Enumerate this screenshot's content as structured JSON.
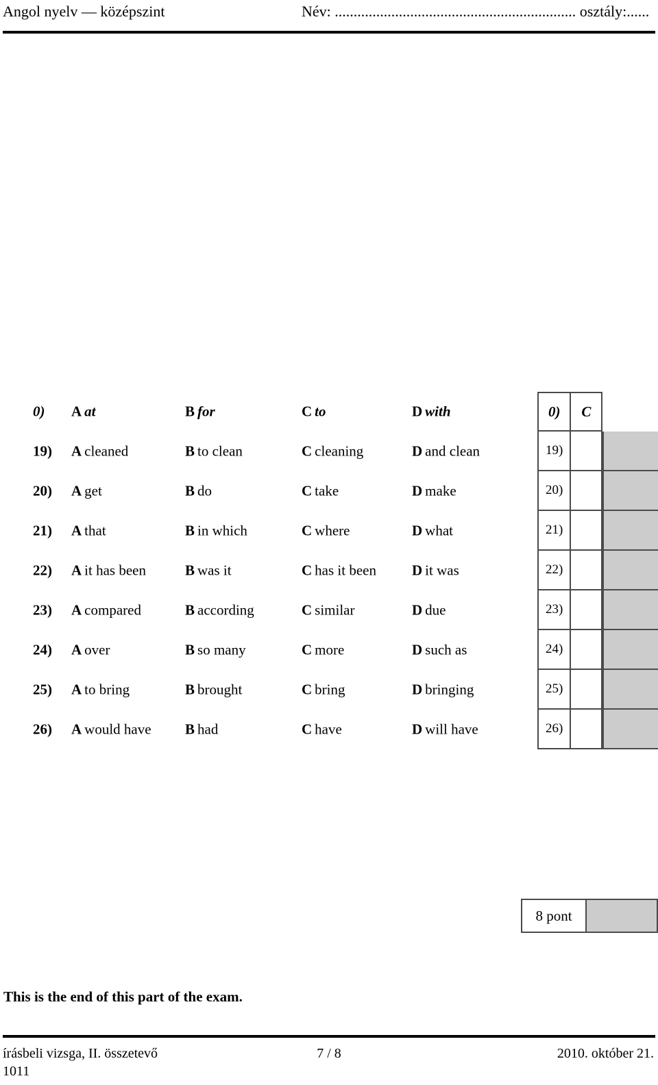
{
  "header": {
    "subject": "Angol nyelv — középszint",
    "name_field": "Név: ................................................................ osztály:......"
  },
  "example_row": {
    "number": "0)",
    "options": [
      {
        "letter": "A",
        "text": "at"
      },
      {
        "letter": "B",
        "text": "for"
      },
      {
        "letter": "C",
        "text": "to"
      },
      {
        "letter": "D",
        "text": "with"
      }
    ],
    "answer_number": "0)",
    "answer_value": "C"
  },
  "questions": [
    {
      "number": "19)",
      "options": [
        {
          "letter": "A",
          "text": "cleaned"
        },
        {
          "letter": "B",
          "text": "to clean"
        },
        {
          "letter": "C",
          "text": "cleaning"
        },
        {
          "letter": "D",
          "text": "and clean"
        }
      ],
      "answer_number": "19)",
      "answer_value": ""
    },
    {
      "number": "20)",
      "options": [
        {
          "letter": "A",
          "text": "get"
        },
        {
          "letter": "B",
          "text": "do"
        },
        {
          "letter": "C",
          "text": "take"
        },
        {
          "letter": "D",
          "text": "make"
        }
      ],
      "answer_number": "20)",
      "answer_value": ""
    },
    {
      "number": "21)",
      "options": [
        {
          "letter": "A",
          "text": "that"
        },
        {
          "letter": "B",
          "text": "in which"
        },
        {
          "letter": "C",
          "text": "where"
        },
        {
          "letter": "D",
          "text": "what"
        }
      ],
      "answer_number": "21)",
      "answer_value": ""
    },
    {
      "number": "22)",
      "options": [
        {
          "letter": "A",
          "text": "it has been"
        },
        {
          "letter": "B",
          "text": "was it"
        },
        {
          "letter": "C",
          "text": "has it been"
        },
        {
          "letter": "D",
          "text": "it was"
        }
      ],
      "answer_number": "22)",
      "answer_value": ""
    },
    {
      "number": "23)",
      "options": [
        {
          "letter": "A",
          "text": "compared"
        },
        {
          "letter": "B",
          "text": "according"
        },
        {
          "letter": "C",
          "text": "similar"
        },
        {
          "letter": "D",
          "text": "due"
        }
      ],
      "answer_number": "23)",
      "answer_value": ""
    },
    {
      "number": "24)",
      "options": [
        {
          "letter": "A",
          "text": "over"
        },
        {
          "letter": "B",
          "text": "so many"
        },
        {
          "letter": "C",
          "text": "more"
        },
        {
          "letter": "D",
          "text": "such as"
        }
      ],
      "answer_number": "24)",
      "answer_value": ""
    },
    {
      "number": "25)",
      "options": [
        {
          "letter": "A",
          "text": "to bring"
        },
        {
          "letter": "B",
          "text": "brought"
        },
        {
          "letter": "C",
          "text": "bring"
        },
        {
          "letter": "D",
          "text": "bringing"
        }
      ],
      "answer_number": "25)",
      "answer_value": ""
    },
    {
      "number": "26)",
      "options": [
        {
          "letter": "A",
          "text": "would have"
        },
        {
          "letter": "B",
          "text": "had"
        },
        {
          "letter": "C",
          "text": "have"
        },
        {
          "letter": "D",
          "text": "will have"
        }
      ],
      "answer_number": "26)",
      "answer_value": ""
    }
  ],
  "points": {
    "label": "8 pont"
  },
  "end_notice": "This is the end of this part of the exam.",
  "footer": {
    "left": "írásbeli vizsga, II. összetevő",
    "code": "1011",
    "page": "7 / 8",
    "date": "2010. október 21."
  },
  "colors": {
    "shade": "#cccccc",
    "rule": "#000000",
    "cell_border": "#4a4a4a"
  }
}
